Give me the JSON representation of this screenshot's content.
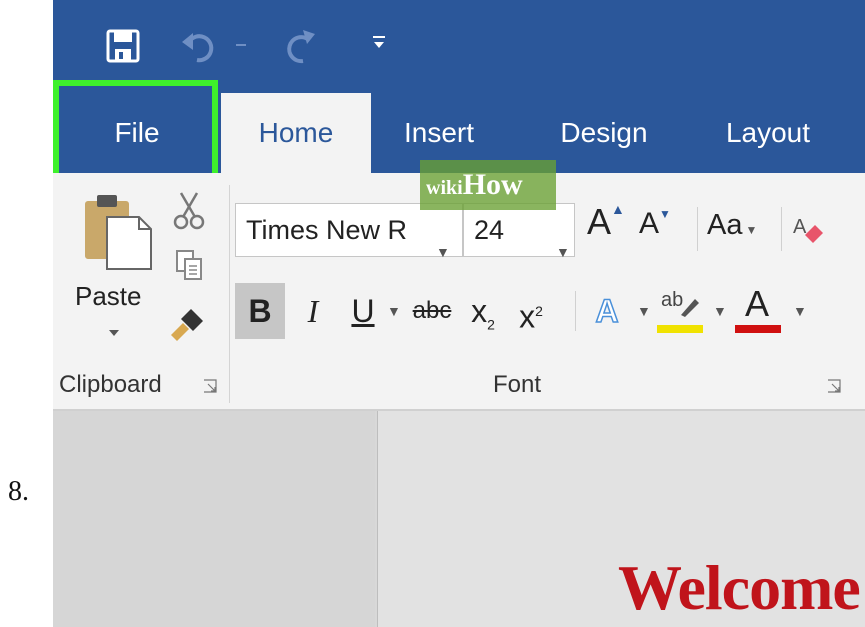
{
  "step": {
    "number": "8."
  },
  "qat": {
    "save_icon": "save-icon",
    "undo_icon": "undo-icon",
    "redo_icon": "redo-icon",
    "customize_icon": "customize-qat-icon"
  },
  "tabs": [
    {
      "label": "File",
      "selected": false,
      "highlighted": true
    },
    {
      "label": "Home",
      "selected": true
    },
    {
      "label": "Insert"
    },
    {
      "label": "Design"
    },
    {
      "label": "Layout"
    }
  ],
  "ribbon": {
    "clipboard": {
      "paste_label": "Paste",
      "group_label": "Clipboard"
    },
    "font": {
      "font_name": "Times New R",
      "font_size": "24",
      "grow_label": "A",
      "shrink_label": "A",
      "change_case_label": "Aa",
      "bold_label": "B",
      "italic_label": "I",
      "underline_label": "U",
      "strike_label": "abc",
      "subscript_label": "x",
      "subscript_sub": "2",
      "superscript_label": "x",
      "superscript_sup": "2",
      "text_effects_label": "A",
      "highlight_label": "ab",
      "font_color_label": "A",
      "group_label": "Font",
      "highlight_color": "#f0e200",
      "font_color": "#d01010"
    }
  },
  "document": {
    "welcome_text": "Welcome",
    "watermark_wiki": "wiki",
    "watermark_how": "How"
  },
  "colors": {
    "accent": "#2b579a",
    "highlight_box": "#3ef02c"
  }
}
